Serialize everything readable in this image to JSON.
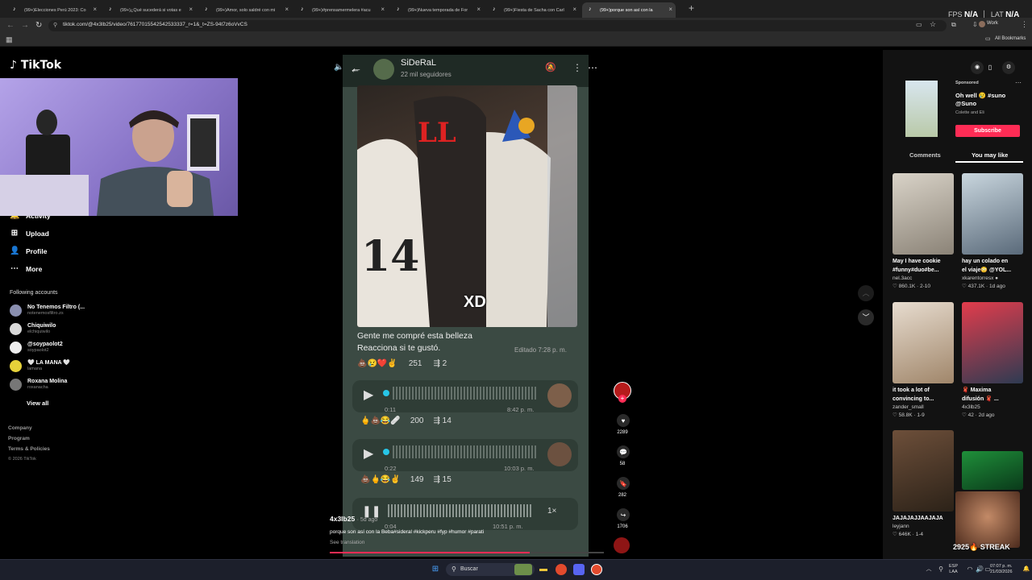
{
  "browser": {
    "tabs": [
      {
        "title": "(99+)Elecciones Perú 2023: Co"
      },
      {
        "title": "(99+)¿Qué sucederá si votas e"
      },
      {
        "title": "(99+)Amor, solo saldré con mi"
      },
      {
        "title": "(99+)#prensamermelera #acu"
      },
      {
        "title": "(99+)Nueva temporada de For"
      },
      {
        "title": "(99+)Fiesta de Sacha con Carl"
      },
      {
        "title": "(99+)porque son así con la"
      }
    ],
    "new_tab": "+",
    "fps_label": "FPS",
    "fps_value": "N/A",
    "lat_label": "LAT",
    "lat_value": "N/A",
    "url": "tiktok.com/@4x3lb25/video/76177015542542533337_r=1&_t=ZS-94t7z6oVvCS",
    "profile": "Work",
    "all_bookmarks": "All Bookmarks"
  },
  "tiktok": {
    "logo": "TikTok",
    "nav": [
      {
        "label": "Activity",
        "icon": "bell-icon"
      },
      {
        "label": "Upload",
        "icon": "plus-square-icon"
      },
      {
        "label": "Profile",
        "icon": "person-icon"
      },
      {
        "label": "More",
        "icon": "dots-icon"
      }
    ],
    "following_header": "Following accounts",
    "accounts": [
      {
        "name": "No Tenemos Filtro (...",
        "handle": "notenemosfiltro.zs",
        "color": "#8a8fb0"
      },
      {
        "name": "Chiquiwilo",
        "handle": "elchiquiwilo",
        "color": "#d8d8d8"
      },
      {
        "name": "@soypaolot2",
        "handle": "soypaolot2",
        "color": "#eee"
      },
      {
        "name": "🤍 LA MANA 🤍",
        "handle": "lamana",
        "color": "#e6d23a"
      },
      {
        "name": "Roxana Molina",
        "handle": "roxanacha",
        "color": "#777"
      }
    ],
    "view_all": "View all",
    "footer": [
      "Company",
      "Program",
      "Terms & Policies"
    ],
    "copyright": "© 2026 TikTok"
  },
  "video": {
    "chat_name": "SiDeRaL",
    "chat_followers": "22 mil seguidores",
    "photo_overlay": "XD",
    "message_line1": "Gente me compré esta belleza",
    "message_line2": "Reacciona si te gustó.",
    "edited": "Editado 7:28 p. m.",
    "msg_reactions": "251",
    "msg_forwards": "2",
    "audio1": {
      "duration": "0:11",
      "time": "8:42 p. m.",
      "reactions": "200",
      "forwards": "14"
    },
    "audio2": {
      "duration": "0:22",
      "time": "10:03 p. m.",
      "reactions": "149",
      "forwards": "15"
    },
    "audio3": {
      "duration": "0:04",
      "time": "10:51 p. m.",
      "speed": "1×"
    },
    "author": "4x3lb25",
    "posted": "· 5d ago",
    "caption": "porque son así con la Beba#sideral #kickperu #fyp #humor #parati",
    "see_translation": "See translation",
    "progress": 0.73,
    "likes": "2289",
    "comments": "58",
    "saves": "282",
    "shares": "1706"
  },
  "right": {
    "sponsored": "Sponsored",
    "ad_title_1": "Oh well 😢 #suno",
    "ad_title_2": "@Suno",
    "ad_sub": "Colette and Eli",
    "subscribe": "Subscribe",
    "tab_comments": "Comments",
    "tab_you_may_like": "You may like",
    "cards": [
      {
        "title1": "May I have cookie",
        "title2": "#funny#duo#be...",
        "user": "nel.3acc",
        "stats": "♡ 860.1K · 2-10",
        "c1": "#d9d3c8",
        "c2": "#8b8377"
      },
      {
        "title1": "hay un colado en",
        "title2": "el viaje😳 @YOL...",
        "user": "xkarentorresx ●",
        "stats": "♡ 437.1K · 1d ago",
        "c1": "#c9d6de",
        "c2": "#5a6a7a"
      },
      {
        "title1": "it took a lot of",
        "title2": "convincing to...",
        "user": "zander_small",
        "stats": "♡ 58.8K · 1-9",
        "c1": "#e7dccf",
        "c2": "#a0866a"
      },
      {
        "title1": "🧣 Maxima",
        "title2": "difusión 🧣 ...",
        "user": "4x3lb25",
        "stats": "♡ 42 · 2d ago",
        "c1": "#e23c4c",
        "c2": "#2e3b52"
      },
      {
        "title1": "JAJAJAJJAAJAJA",
        "title2": "",
        "user": "leyjann",
        "stats": "♡ 646K · 1-4",
        "c1": "#6d4f3a",
        "c2": "#2c2218"
      },
      {
        "title1": "",
        "title2": "",
        "user": "",
        "stats": "",
        "c1": "#1f8f3a",
        "c2": "#0a3a1a"
      }
    ],
    "streak": "2925🔥 STREAK"
  },
  "taskbar": {
    "search": "Buscar",
    "lang1": "ESP",
    "lang2": "LAA",
    "time": "07:07 p. m.",
    "date": "21/03/2026"
  }
}
